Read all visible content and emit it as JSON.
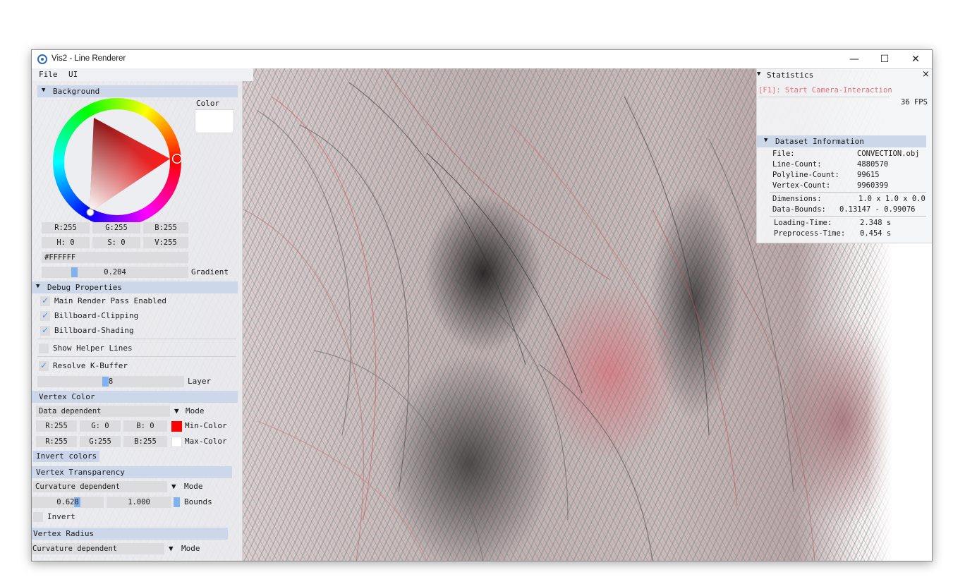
{
  "window": {
    "title": "Vis2 - Line Renderer",
    "minimize": "—",
    "maximize": "☐",
    "close": "✕"
  },
  "menu": {
    "file": "File",
    "ui": "UI"
  },
  "background": {
    "header": "Background",
    "color_label": "Color",
    "selected_color": "#ffffff",
    "r": "R:255",
    "g": "G:255",
    "b": "B:255",
    "h": "H:  0",
    "s": "S:  0",
    "v": "V:255",
    "hex": "#FFFFFF",
    "gradient_value": "0.204",
    "gradient_label": "Gradient"
  },
  "debug": {
    "header": "Debug Properties",
    "main_render_pass": "Main Render Pass Enabled",
    "billboard_clipping": "Billboard-Clipping",
    "billboard_shading": "Billboard-Shading",
    "show_helper_lines": "Show Helper Lines",
    "resolve_kbuffer": "Resolve K-Buffer",
    "layer_value": "8",
    "layer_label": "Layer"
  },
  "vertex_color": {
    "header": "Vertex Color",
    "mode_value": "Data dependent",
    "mode_label": "Mode",
    "min": {
      "r": "R:255",
      "g": "G:  0",
      "b": "B:  0",
      "label": "Min-Color",
      "color": "#ff0000"
    },
    "max": {
      "r": "R:255",
      "g": "G:255",
      "b": "B:255",
      "label": "Max-Color",
      "color": "#ffffff"
    },
    "invert_button": "Invert colors"
  },
  "vertex_transparency": {
    "header": "Vertex Transparency",
    "mode_value": "Curvature dependent",
    "mode_label": "Mode",
    "bound_low": "0.628",
    "bound_high": "1.000",
    "bounds_label": "Bounds",
    "invert_label": "Invert"
  },
  "vertex_radius": {
    "header": "Vertex Radius",
    "mode_value": "Curvature dependent",
    "mode_label": "Mode"
  },
  "statistics": {
    "header": "Statistics",
    "close": "×",
    "camera_hint": "[F1]: Start Camera-Interaction",
    "fps": "36 FPS",
    "dataset_header": "Dataset Information",
    "rows": [
      {
        "key": "File:",
        "value": "CONVECTION.obj"
      },
      {
        "key": "Line-Count:",
        "value": "4880570"
      },
      {
        "key": "Polyline-Count:",
        "value": "99615"
      },
      {
        "key": "Vertex-Count:",
        "value": "9960399"
      },
      {
        "key": "Dimensions:",
        "value": "1.0 x 1.0 x 0.0"
      },
      {
        "key": "Data-Bounds:",
        "value": "0.13147 - 0.99076"
      },
      {
        "key": "Loading-Time:",
        "value": "2.348 s"
      },
      {
        "key": "Preprocess-Time:",
        "value": "0.454 s"
      }
    ]
  },
  "icons": {
    "app": "app-logo-icon",
    "collapse": "triangle-down-icon",
    "check": "checkmark-icon"
  }
}
